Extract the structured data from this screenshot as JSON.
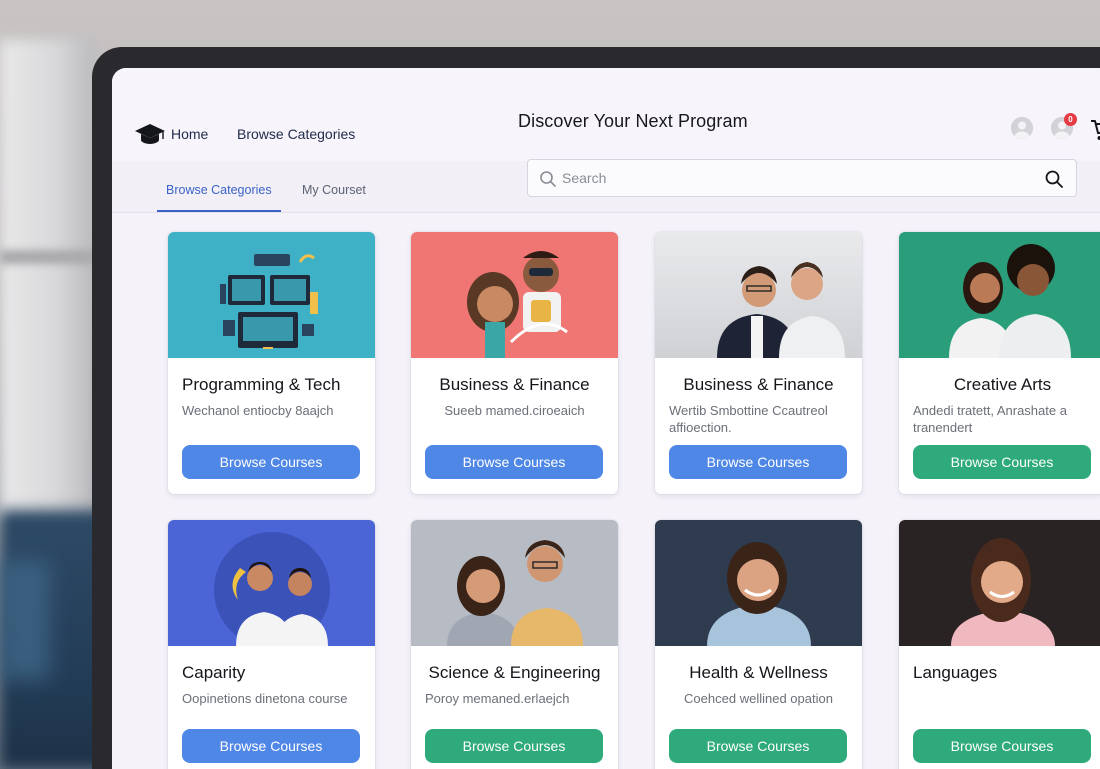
{
  "header": {
    "nav": {
      "home": "Home",
      "browse": "Browse Categories"
    },
    "title": "Discover Your Next Program",
    "notification_count": "0"
  },
  "tabs": {
    "browse": "Browse Categories",
    "my": "My Courset"
  },
  "search": {
    "placeholder": "Search",
    "value": ""
  },
  "cards": [
    {
      "title": "Programming & Tech",
      "desc": "Wechanol entiocby 8aajch",
      "button": "Browse Courses",
      "button_color": "#4f87e6",
      "image": "tech-illustration"
    },
    {
      "title": "Business & Finance",
      "desc": "Sueeb mamed.ciroeaich",
      "button": "Browse Courses",
      "button_color": "#4f87e6",
      "image": "cartoon-characters"
    },
    {
      "title": "Business & Finance",
      "desc": "Wertib Smbottine Ccautreol affioection.",
      "button": "Browse Courses",
      "button_color": "#4f87e6",
      "image": "two-men-photo"
    },
    {
      "title": "Creative Arts",
      "desc": "Andedi tratett, Anrashate a tranendert",
      "button": "Browse Courses",
      "button_color": "#2faa7b",
      "image": "couple-photo"
    },
    {
      "title": "Caparity",
      "desc": "Oopinetions dinetona course",
      "button": "Browse Courses",
      "button_color": "#4f87e6",
      "image": "two-boys-illustration"
    },
    {
      "title": "Science & Engineering",
      "desc": "Poroy memaned.erlaejch",
      "button": "Browse Courses",
      "button_color": "#2faa7b",
      "image": "man-woman-photo"
    },
    {
      "title": "Health & Wellness",
      "desc": "Coehced wellined opation",
      "button": "Browse Courses",
      "button_color": "#2faa7b",
      "image": "woman-portrait"
    },
    {
      "title": "Languages",
      "desc": "",
      "button": "Browse Courses",
      "button_color": "#2faa7b",
      "image": "woman-smile-portrait"
    }
  ]
}
